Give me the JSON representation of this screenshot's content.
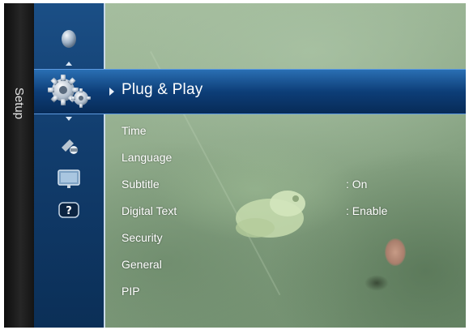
{
  "side_tab": {
    "label": "Setup"
  },
  "icons": {
    "above": "globe-icon",
    "selected": "gear-icon",
    "below": [
      "satellite-icon",
      "tv-screen-icon",
      "help-icon"
    ]
  },
  "selected_item": {
    "label": "Plug & Play"
  },
  "menu": {
    "items": [
      {
        "label": "Time",
        "value": ""
      },
      {
        "label": "Language",
        "value": ""
      },
      {
        "label": "Subtitle",
        "value": ": On"
      },
      {
        "label": "Digital Text",
        "value": ": Enable"
      },
      {
        "label": "Security",
        "value": ""
      },
      {
        "label": "General",
        "value": ""
      },
      {
        "label": "PIP",
        "value": ""
      }
    ]
  },
  "colors": {
    "highlight": "#0d3e78",
    "icon_column": "#123e6f",
    "side_tab": "#1a1a1a",
    "text": "#ffffff"
  }
}
